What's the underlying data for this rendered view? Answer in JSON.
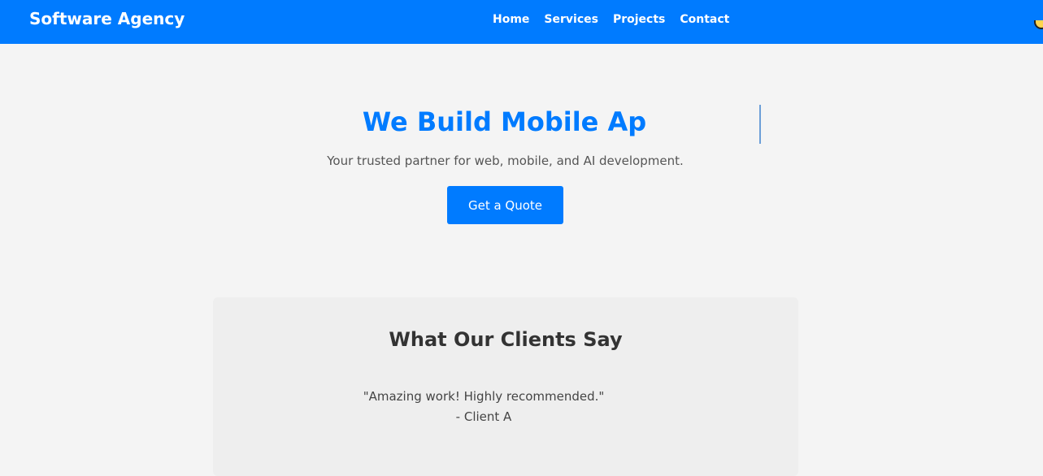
{
  "navbar": {
    "brand": "Software Agency",
    "links": [
      {
        "label": "Home"
      },
      {
        "label": "Services"
      },
      {
        "label": "Projects"
      },
      {
        "label": "Contact"
      }
    ],
    "background_color": "#007bff"
  },
  "hero": {
    "title": "We Build Mobile Ap",
    "subtitle": "Your trusted partner for web, mobile, and AI development.",
    "button_label": "Get a Quote",
    "accent_color": "#007bff"
  },
  "testimonials": {
    "title": "What Our Clients Say",
    "items": [
      {
        "quote": "\"Amazing work! Highly recommended.\"",
        "author": "- Client A"
      }
    ]
  }
}
